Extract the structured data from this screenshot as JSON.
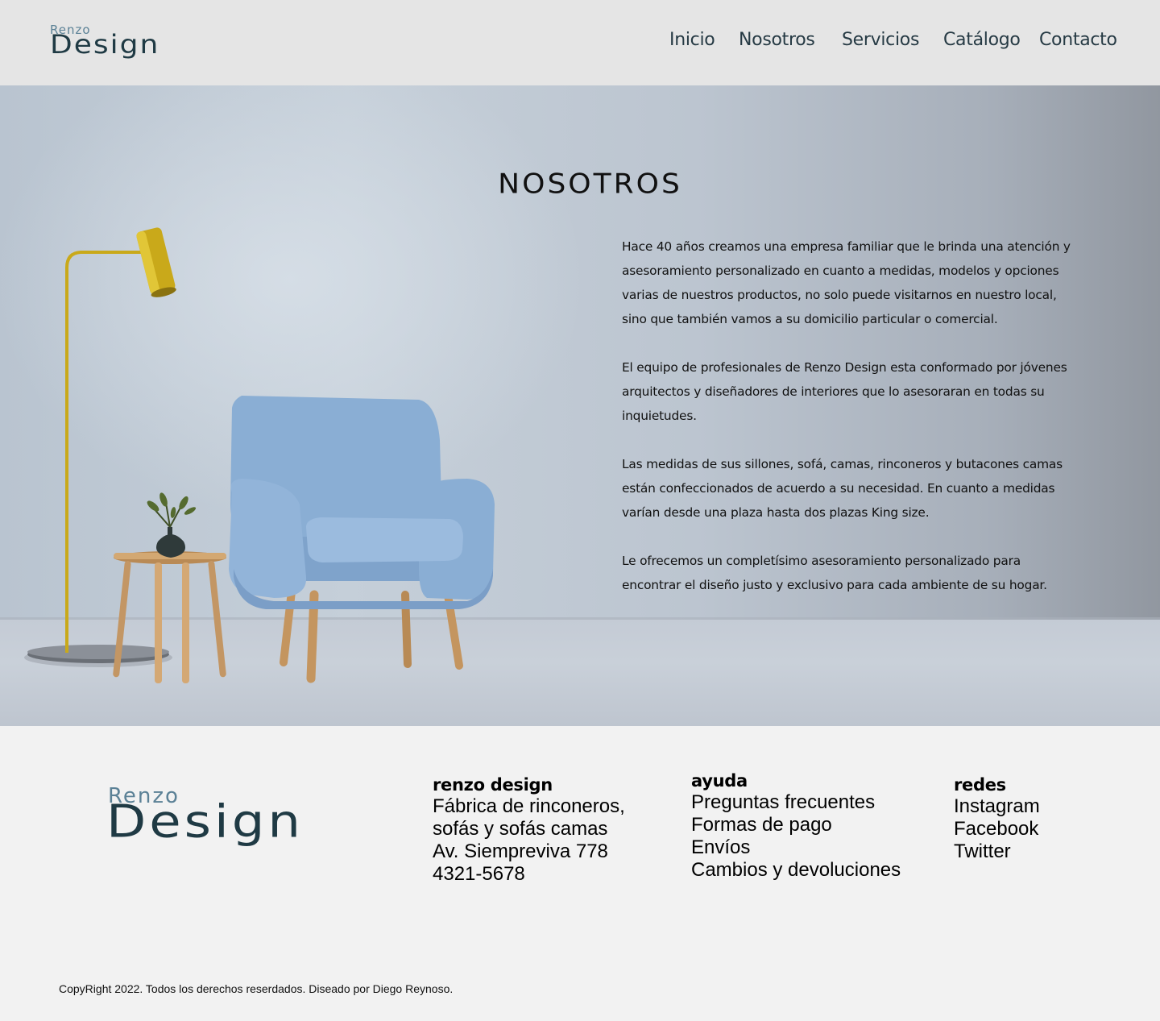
{
  "brand": {
    "logo_top": "Renzo",
    "logo_bottom": "Design"
  },
  "nav": {
    "items": [
      "Inicio",
      "Nosotros",
      "Servicios",
      "Catálogo",
      "Contacto"
    ]
  },
  "hero": {
    "title": "NOSOTROS",
    "paragraphs": [
      "Hace 40 años creamos una empresa familiar que le brinda una atención y asesoramiento personalizado en cuanto a medidas, modelos y opciones varias de nuestros productos, no solo puede visitarnos en nuestro local, sino que también vamos a su domicilio particular o comercial.",
      "El equipo de profesionales de Renzo Design esta conformado por jóvenes arquitectos y diseñadores de interiores que lo asesoraran en todas su inquietudes.",
      "Las medidas de sus sillones, sofá, camas, rinconeros y butacones camas están confeccionados de acuerdo a su necesidad. En cuanto a medidas varían desde una plaza hasta dos plazas King size.",
      "Le ofrecemos un completísimo asesoramiento personalizado para encontrar el diseño justo y exclusivo para cada ambiente de su hogar."
    ]
  },
  "footer": {
    "company": {
      "heading": "renzo design",
      "lines": [
        "Fábrica de rinconeros,",
        "sofás y sofás camas",
        "Av. Siempreviva 778",
        "4321-5678"
      ]
    },
    "help": {
      "heading": "ayuda",
      "lines": [
        "Preguntas frecuentes",
        "Formas de pago",
        "Envíos",
        "Cambios y devoluciones"
      ]
    },
    "social": {
      "heading": "redes",
      "lines": [
        "Instagram",
        "Facebook",
        "Twitter"
      ]
    },
    "copyright": "CopyRight 2022. Todos los derechos reserdados. Diseado por Diego Reynoso."
  },
  "colors": {
    "header_bg": "#e5e5e5",
    "nav_text": "#263a44",
    "logo_accent": "#5b8196",
    "logo_dark": "#1f3a44",
    "chair_blue": "#8fb0d6",
    "lamp_gold": "#c9a91a",
    "footer_bg": "#f2f2f2"
  }
}
